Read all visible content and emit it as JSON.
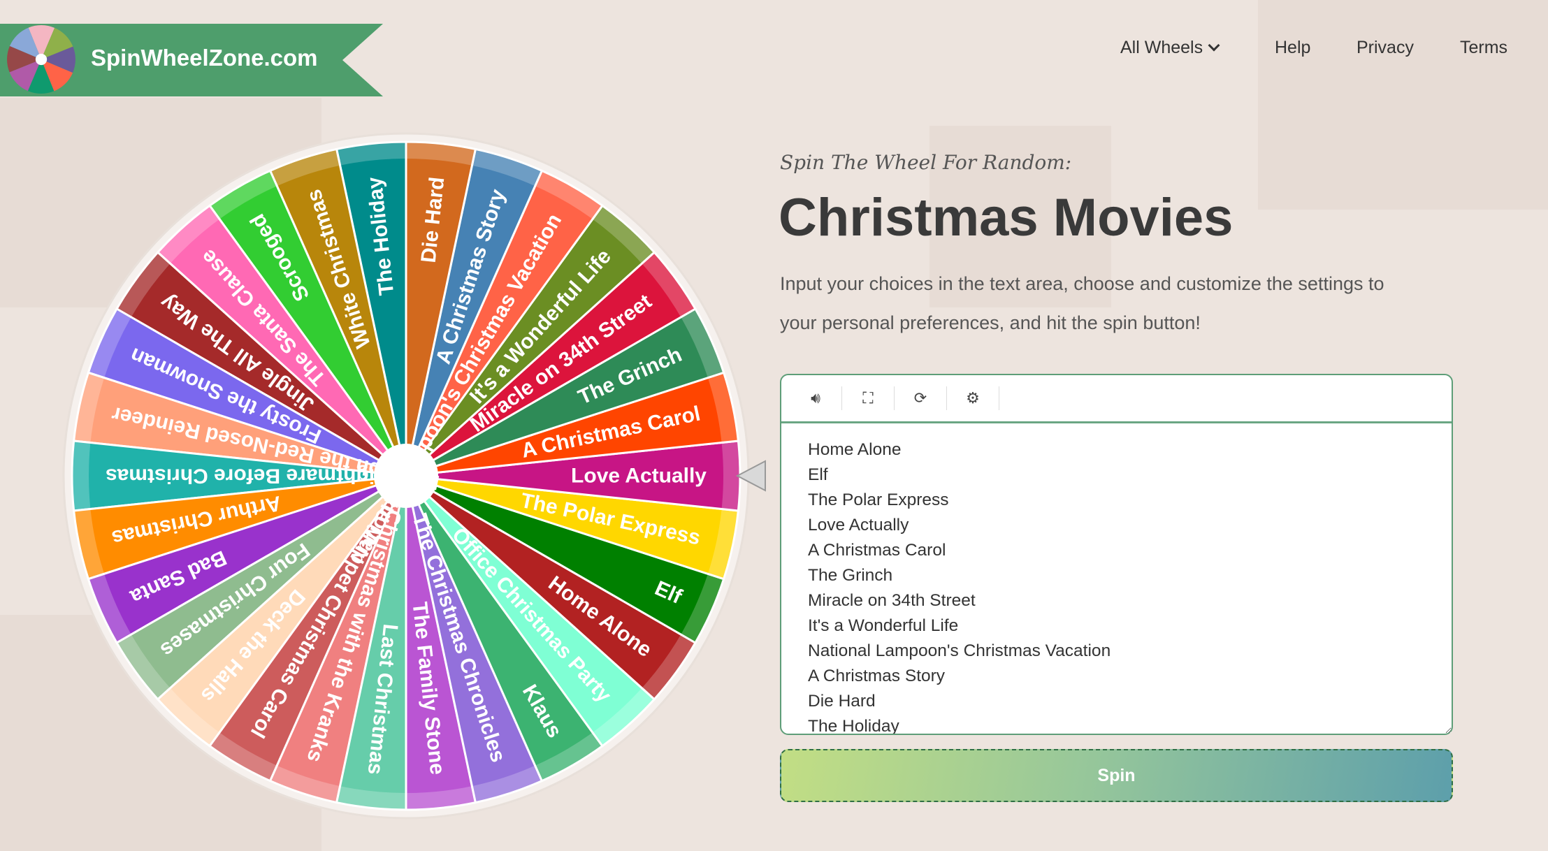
{
  "brand": {
    "name": "SpinWheelZone.com",
    "colors": [
      "#f4b6c2",
      "#8fb04a",
      "#6a5a9a",
      "#ff6347",
      "#0f9a6e",
      "#b05aa8",
      "#964848",
      "#8aa8d8"
    ]
  },
  "nav": {
    "items": [
      {
        "label": "All Wheels",
        "icon": "chevron-down-icon"
      },
      {
        "label": "Help"
      },
      {
        "label": "Privacy"
      },
      {
        "label": "Terms"
      }
    ]
  },
  "hero": {
    "kicker": "Spin The Wheel For Random:",
    "title": "Christmas Movies",
    "description": "Input your choices in the text area, choose and customize the settings to your personal preferences, and hit the spin button!"
  },
  "toolbar": {
    "icons": [
      "volume-icon",
      "fullscreen-icon",
      "refresh-icon",
      "gear-icon"
    ]
  },
  "items": [
    {
      "label": "Home Alone",
      "color": "#b22222"
    },
    {
      "label": "Elf",
      "color": "#008000"
    },
    {
      "label": "The Polar Express",
      "color": "#ffd700"
    },
    {
      "label": "Love Actually",
      "color": "#c71585"
    },
    {
      "label": "A Christmas Carol",
      "color": "#ff4500"
    },
    {
      "label": "The Grinch",
      "color": "#2e8b57"
    },
    {
      "label": "Miracle on 34th Street",
      "color": "#dc143c"
    },
    {
      "label": "It's a Wonderful Life",
      "color": "#6b8e23"
    },
    {
      "label": "National Lampoon's Christmas Vacation",
      "color": "#ff6347"
    },
    {
      "label": "A Christmas Story",
      "color": "#4682b4"
    },
    {
      "label": "Die Hard",
      "color": "#d2691e"
    },
    {
      "label": "The Holiday",
      "color": "#008b8b"
    },
    {
      "label": "White Christmas",
      "color": "#b8860b"
    },
    {
      "label": "Scrooged",
      "color": "#32cd32"
    },
    {
      "label": "The Santa Clause",
      "color": "#ff69b4"
    },
    {
      "label": "Jingle All The Way",
      "color": "#a52a2a"
    },
    {
      "label": "Frosty the Snowman",
      "color": "#7b68ee"
    },
    {
      "label": "Rudolph the Red-Nosed Reindeer",
      "color": "#ffa07a"
    },
    {
      "label": "The Nightmare Before Christmas",
      "color": "#20b2aa"
    },
    {
      "label": "Arthur Christmas",
      "color": "#ff8c00"
    },
    {
      "label": "Bad Santa",
      "color": "#9932cc"
    },
    {
      "label": "Four Christmases",
      "color": "#8fbc8f"
    },
    {
      "label": "Deck the Halls",
      "color": "#ffdab9"
    },
    {
      "label": "The Muppet Christmas Carol",
      "color": "#cd5c5c"
    },
    {
      "label": "Christmas with the Kranks",
      "color": "#f08080"
    },
    {
      "label": "Last Christmas",
      "color": "#66cdaa"
    },
    {
      "label": "The Family Stone",
      "color": "#ba55d3"
    },
    {
      "label": "The Christmas Chronicles",
      "color": "#9370db"
    },
    {
      "label": "Klaus",
      "color": "#3cb371"
    },
    {
      "label": "Office Christmas Party",
      "color": "#7fffd4"
    }
  ],
  "pointer_item": "Love Actually",
  "spin_label": "Spin"
}
